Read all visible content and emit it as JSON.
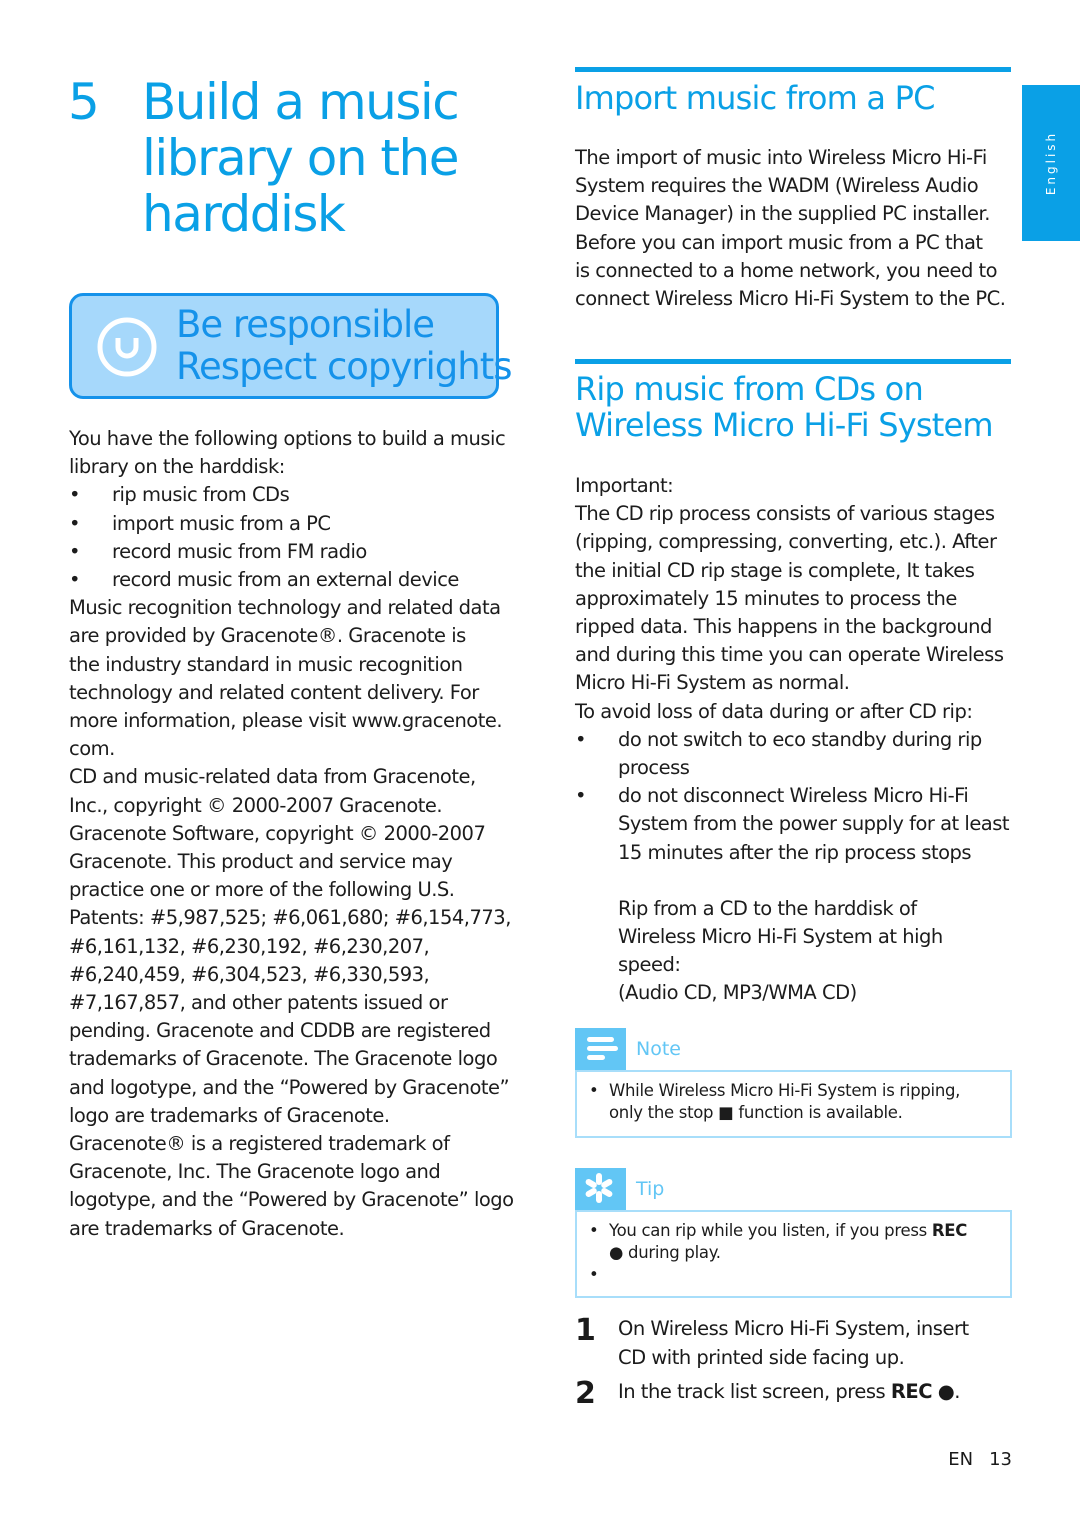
{
  "chapter": {
    "number": "5",
    "title_lines": [
      "Build a music",
      "library on the",
      "harddisk"
    ]
  },
  "banner": {
    "icon": "copyright-respect-icon",
    "line1": "Be responsible",
    "line2": "Respect copyrights"
  },
  "left_column": {
    "intro_lines": [
      "You have the following options to build a music",
      "library on the harddisk:"
    ],
    "options": [
      "rip music from CDs",
      "import music from a PC",
      "record music from FM radio",
      "record music from an external device"
    ],
    "bullet": "•",
    "gracenote_para_1": [
      "Music recognition technology and related data",
      "are provided by Gracenote®. Gracenote is",
      "the industry standard in music recognition",
      "technology and related content delivery. For",
      "more information, please visit www.gracenote.",
      "com."
    ],
    "gracenote_para_2": [
      "CD and music-related data from Gracenote,",
      "Inc., copyright © 2000-2007 Gracenote.",
      "Gracenote Software, copyright © 2000-2007",
      "Gracenote. This product and service may",
      "practice one or more of the following U.S.",
      "Patents: #5,987,525; #6,061,680; #6,154,773,",
      "#6,161,132, #6,230,192, #6,230,207,",
      "#6,240,459, #6,304,523, #6,330,593,",
      "#7,167,857, and other patents issued or",
      "pending. Gracenote and CDDB are registered",
      "trademarks of Gracenote. The Gracenote logo",
      "and logotype, and the “Powered by Gracenote”",
      "logo are trademarks of Gracenote.",
      "Gracenote® is a registered trademark of",
      "Gracenote, Inc. The Gracenote logo and",
      "logotype, and the “Powered by Gracenote” logo",
      "are trademarks of Gracenote."
    ]
  },
  "import_section": {
    "heading": "Import music from a PC",
    "body_lines": [
      "The import of music into Wireless Micro Hi-Fi",
      "System requires the WADM (Wireless Audio",
      "Device Manager) in the supplied PC installer.",
      "Before you can import music from a PC that",
      "is connected to a home network, you need to",
      "connect Wireless Micro Hi-Fi System to the PC."
    ]
  },
  "language_tab": {
    "label": "English"
  },
  "rip_section": {
    "heading_lines": [
      "Rip music from CDs on",
      "Wireless Micro Hi-Fi System"
    ],
    "important_label": "Important:",
    "important_lines": [
      "The CD rip process consists of various stages",
      "(ripping, compressing, converting, etc.). After",
      "the initial CD rip stage is complete, It takes",
      "approximately 15 minutes to process the",
      "ripped data. This happens in the background",
      "and during this time you can operate Wireless",
      "Micro Hi-Fi System as normal."
    ],
    "avoid_intro": "To avoid loss of data during or after CD rip:",
    "avoid_bullets": [
      {
        "lines": [
          "do not switch to eco standby during rip",
          "process"
        ]
      },
      {
        "lines": [
          "do not disconnect Wireless Micro Hi-Fi",
          "System from the power supply for at least",
          "15 minutes after the rip process stops"
        ]
      }
    ],
    "speed_lines": [
      "Rip from a CD to the harddisk of",
      "Wireless Micro Hi-Fi System at high",
      "speed:",
      "(Audio CD, MP3/WMA CD)"
    ],
    "note": {
      "label": "Note",
      "icon": "note-lines-icon",
      "line1": "While Wireless Micro Hi-Fi System is ripping,",
      "line2_before": "only the stop ",
      "line2_symbol": "■",
      "line2_after": " function is available."
    },
    "tip": {
      "label": "Tip",
      "icon": "asterisk-icon",
      "line1_before": "You can rip while you listen, if you press ",
      "line1_key": "REC",
      "line2_symbol": "●",
      "line2_after": " during play.",
      "empty_bullet": ""
    },
    "steps": [
      {
        "number": "1",
        "lines": [
          "On Wireless Micro Hi-Fi System, insert",
          "CD with printed side facing up."
        ]
      },
      {
        "number": "2",
        "before": "In the track list screen, press ",
        "key": "REC",
        "symbol": " ●",
        "after": "."
      }
    ]
  },
  "footer": {
    "lang": "EN",
    "page": "13"
  },
  "colors": {
    "accent": "#0aa0e6",
    "banner_bg": "#a6d8fb",
    "banner_border": "#1592ea",
    "callout": "#62c6f5",
    "callout_border": "#a8defa"
  }
}
